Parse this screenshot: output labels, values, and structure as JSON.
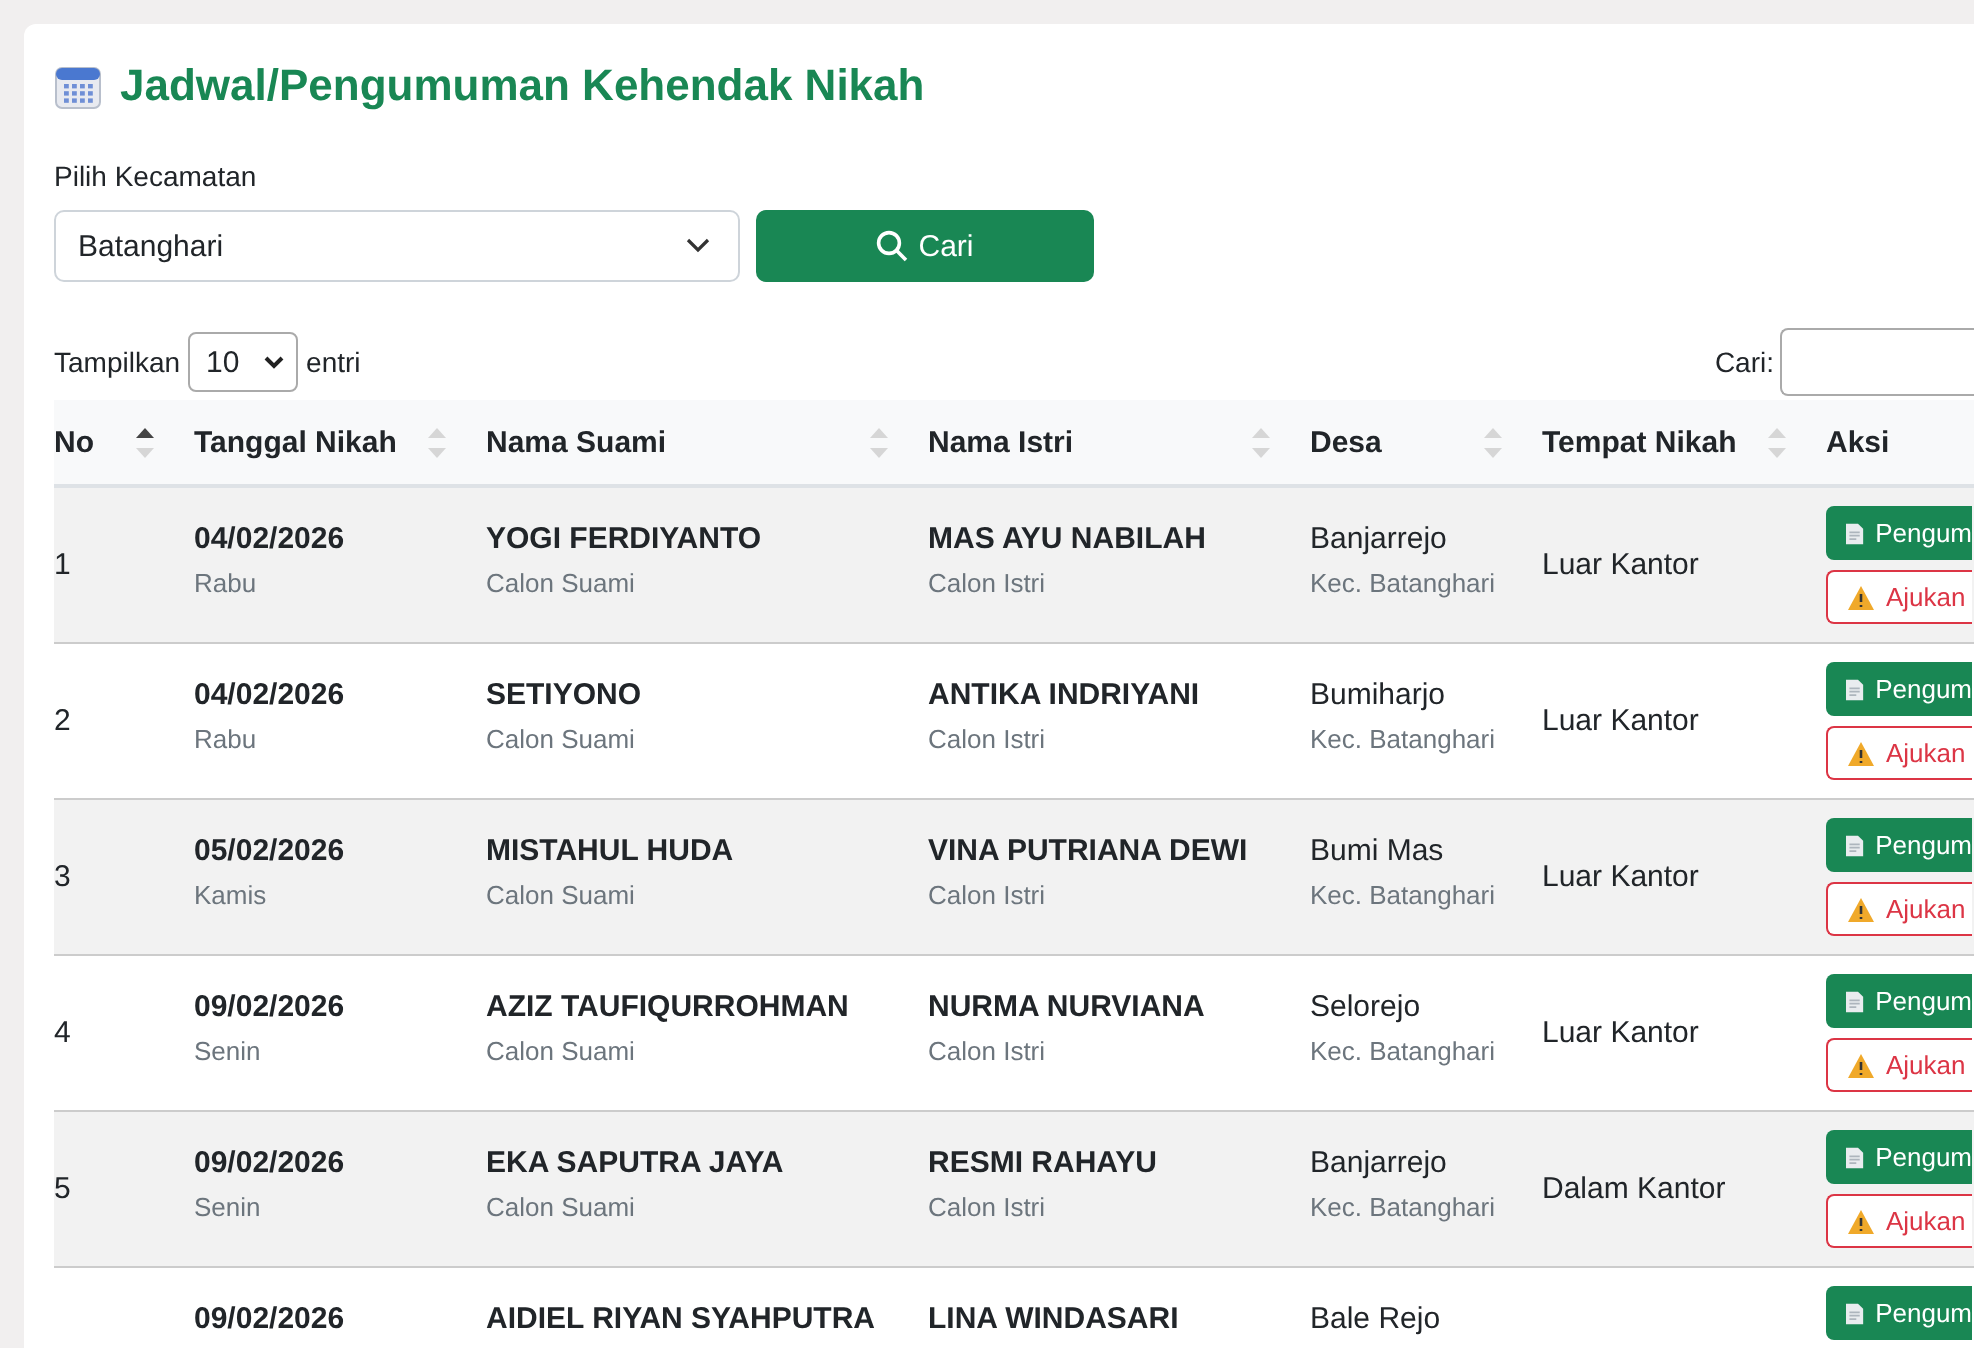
{
  "title": "Jadwal/Pengumuman Kehendak Nikah",
  "filter": {
    "label": "Pilih Kecamatan",
    "value": "Batanghari",
    "button": "Cari"
  },
  "length": {
    "prefix": "Tampilkan",
    "value": "10",
    "suffix": "entri"
  },
  "search": {
    "label": "Cari:"
  },
  "table": {
    "columns": [
      {
        "label": "No",
        "sorted": true
      },
      {
        "label": "Tanggal Nikah",
        "sorted": false
      },
      {
        "label": "Nama Suami",
        "sorted": false
      },
      {
        "label": "Nama Istri",
        "sorted": false
      },
      {
        "label": "Desa",
        "sorted": false
      },
      {
        "label": "Tempat Nikah",
        "sorted": false
      },
      {
        "label": "Aksi"
      }
    ],
    "rows": [
      {
        "no": "1",
        "date": "04/02/2026",
        "day": "Rabu",
        "suami": "YOGI FERDIYANTO",
        "suami_role": "Calon Suami",
        "istri": "MAS AYU NABILAH",
        "istri_role": "Calon Istri",
        "desa": "Banjarrejo",
        "kec": "Kec. Batanghari",
        "tempat": "Luar Kantor",
        "actions": [
          {
            "kind": "primary",
            "label": "Pengum"
          },
          {
            "kind": "warning",
            "label": "Ajukan"
          }
        ]
      },
      {
        "no": "2",
        "date": "04/02/2026",
        "day": "Rabu",
        "suami": "SETIYONO",
        "suami_role": "Calon Suami",
        "istri": "ANTIKA INDRIYANI",
        "istri_role": "Calon Istri",
        "desa": "Bumiharjo",
        "kec": "Kec. Batanghari",
        "tempat": "Luar Kantor",
        "actions": [
          {
            "kind": "primary",
            "label": "Pengum"
          },
          {
            "kind": "warning",
            "label": "Ajukan"
          }
        ]
      },
      {
        "no": "3",
        "date": "05/02/2026",
        "day": "Kamis",
        "suami": "MISTAHUL HUDA",
        "suami_role": "Calon Suami",
        "istri": "VINA PUTRIANA DEWI",
        "istri_role": "Calon Istri",
        "desa": "Bumi Mas",
        "kec": "Kec. Batanghari",
        "tempat": "Luar Kantor",
        "actions": [
          {
            "kind": "primary",
            "label": "Pengum"
          },
          {
            "kind": "warning",
            "label": "Ajukan"
          }
        ]
      },
      {
        "no": "4",
        "date": "09/02/2026",
        "day": "Senin",
        "suami": "AZIZ TAUFIQURROHMAN",
        "suami_role": "Calon Suami",
        "istri": "NURMA NURVIANA",
        "istri_role": "Calon Istri",
        "desa": "Selorejo",
        "kec": "Kec. Batanghari",
        "tempat": "Luar Kantor",
        "actions": [
          {
            "kind": "primary",
            "label": "Pengum"
          },
          {
            "kind": "warning",
            "label": "Ajukan"
          }
        ]
      },
      {
        "no": "5",
        "date": "09/02/2026",
        "day": "Senin",
        "suami": "EKA SAPUTRA JAYA",
        "suami_role": "Calon Suami",
        "istri": "RESMI RAHAYU",
        "istri_role": "Calon Istri",
        "desa": "Banjarrejo",
        "kec": "Kec. Batanghari",
        "tempat": "Dalam Kantor",
        "actions": [
          {
            "kind": "primary",
            "label": "Pengum"
          },
          {
            "kind": "warning",
            "label": "Ajukan"
          }
        ]
      },
      {
        "date": "09/02/2026",
        "suami": "AIDIEL RIYAN SYAHPUTRA",
        "istri": "LINA WINDASARI",
        "desa": "Bale Rejo",
        "actions": [
          {
            "kind": "primary",
            "label": "Pengum"
          }
        ]
      }
    ]
  }
}
